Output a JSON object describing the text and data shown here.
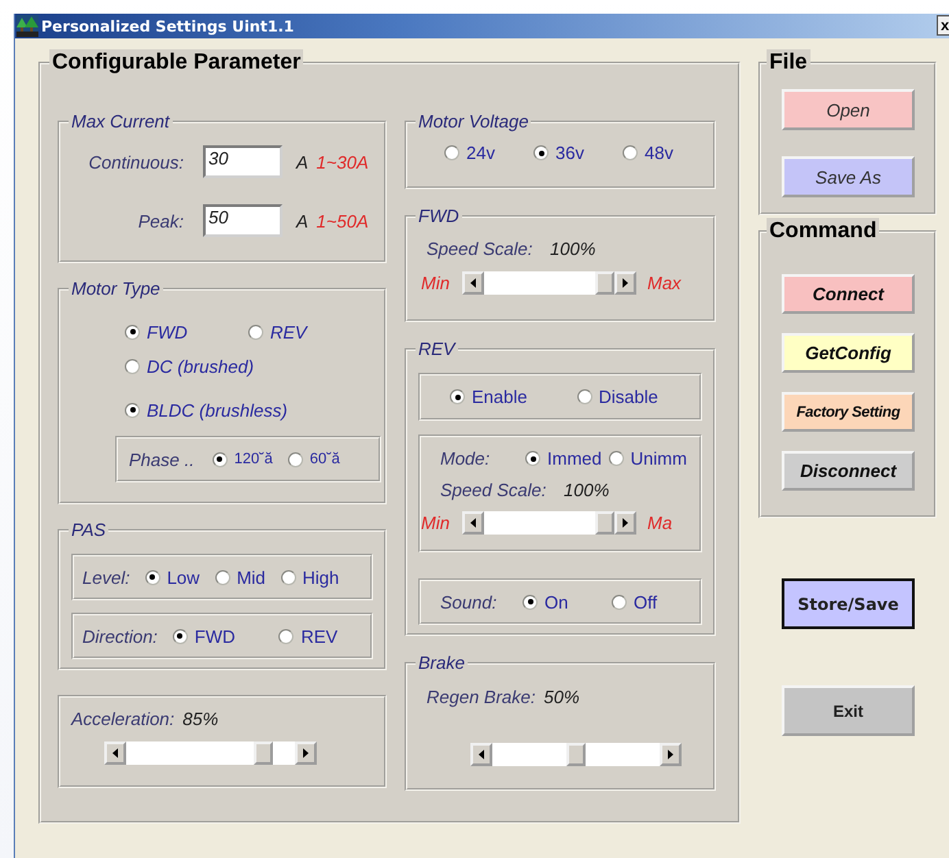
{
  "window": {
    "title": "Personalized Settings Uint1.1",
    "close": "x"
  },
  "config": {
    "title": "Configurable Parameter",
    "max_current": {
      "title": "Max Current",
      "fields": [
        {
          "label": "Continuous:",
          "value": "30",
          "unit": "A",
          "range": "1~30A"
        },
        {
          "label": "Peak:",
          "value": "50",
          "unit": "A",
          "range": "1~50A"
        }
      ]
    },
    "motor_type": {
      "title": "Motor Type",
      "direction": [
        {
          "label": "FWD",
          "selected": true
        },
        {
          "label": "REV",
          "selected": false
        }
      ],
      "types": [
        {
          "label": "DC (brushed)",
          "selected": false
        },
        {
          "label": "BLDC (brushless)",
          "selected": true
        }
      ],
      "phase": {
        "label": "Phase ..",
        "options": [
          {
            "label": "120˘ă",
            "selected": true
          },
          {
            "label": "60˘ă",
            "selected": false
          }
        ]
      }
    },
    "pas": {
      "title": "PAS",
      "level": {
        "label": "Level:",
        "options": [
          {
            "label": "Low",
            "selected": true
          },
          {
            "label": "Mid",
            "selected": false
          },
          {
            "label": "High",
            "selected": false
          }
        ]
      },
      "direction": {
        "label": "Direction:",
        "options": [
          {
            "label": "FWD",
            "selected": true
          },
          {
            "label": "REV",
            "selected": false
          }
        ]
      }
    },
    "acceleration": {
      "label": "Acceleration:",
      "reading": "85%",
      "level": 0.85
    },
    "motor_voltage": {
      "title": "Motor Voltage",
      "options": [
        {
          "label": "24v",
          "selected": false
        },
        {
          "label": "36v",
          "selected": true
        },
        {
          "label": "48v",
          "selected": false
        }
      ]
    },
    "fwd": {
      "title": "FWD",
      "label": "Speed Scale:",
      "reading": "100%",
      "min": "Min",
      "max": "Max",
      "level": 1
    },
    "rev": {
      "title": "REV",
      "enable": [
        {
          "label": "Enable",
          "selected": true
        },
        {
          "label": "Disable",
          "selected": false
        }
      ],
      "mode": {
        "label": "Mode:",
        "options": [
          {
            "label": "Immed",
            "selected": true
          },
          {
            "label": "Unimm",
            "selected": false
          }
        ]
      },
      "label": "Speed Scale:",
      "reading": "100%",
      "min": "Min",
      "max": "Ma",
      "level": 1,
      "sound": {
        "label": "Sound:",
        "options": [
          {
            "label": "On",
            "selected": true
          },
          {
            "label": "Off",
            "selected": false
          }
        ]
      }
    },
    "brake": {
      "title": "Brake",
      "label": "Regen Brake:",
      "reading": "50%",
      "level": 0.5
    }
  },
  "file": {
    "title": "File",
    "buttons": [
      {
        "label": "Open",
        "color": "#f8c4c4"
      },
      {
        "label": "Save As",
        "color": "#c4c4f8"
      }
    ]
  },
  "command": {
    "title": "Command",
    "buttons": [
      {
        "label": "Connect",
        "color": "#f8c0c0"
      },
      {
        "label": "GetConfig",
        "color": "#ffffc4"
      },
      {
        "label": "Factory Setting",
        "color": "#fcd6b8"
      },
      {
        "label": "Disconnect",
        "color": "#cdcdcd"
      }
    ]
  },
  "buttons": [
    {
      "label": "Store/Save",
      "color": "#c4c4ff",
      "default": true
    },
    {
      "label": "Exit",
      "color": "#c4c4c4",
      "default": false
    }
  ]
}
